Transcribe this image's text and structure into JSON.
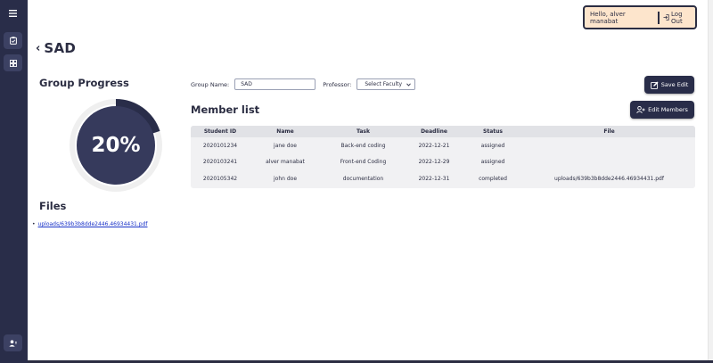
{
  "sidebar": {
    "icons": [
      "menu-icon",
      "clipboard-icon",
      "grid-icon",
      "user-icon"
    ]
  },
  "header": {
    "greeting": "Hello, alver manabat",
    "logout_label": "Log Out"
  },
  "page": {
    "back_icon": "chevron-left-icon",
    "title": "SAD"
  },
  "progress": {
    "heading": "Group Progress",
    "percent_label": "20%",
    "value": 0.2
  },
  "files": {
    "heading": "Files",
    "items": [
      "uploads/639b3b8dde2446.46934431.pdf"
    ]
  },
  "form": {
    "group_name_label": "Group Name:",
    "group_name_value": "SAD",
    "professor_label": "Professor:",
    "professor_selected": "Select Faculty"
  },
  "buttons": {
    "save_label": "Save Edit",
    "edit_members_label": "Edit Members"
  },
  "members": {
    "heading": "Member list",
    "columns": [
      "Student ID",
      "Name",
      "Task",
      "Deadline",
      "Status",
      "File"
    ],
    "rows": [
      {
        "id": "2020101234",
        "name": "jane doe",
        "task": "Back-end coding",
        "deadline": "2022-12-21",
        "status": "assigned",
        "file": ""
      },
      {
        "id": "2020103241",
        "name": "alver manabat",
        "task": "Front-end Coding",
        "deadline": "2022-12-29",
        "status": "assigned",
        "file": ""
      },
      {
        "id": "2020105342",
        "name": "john doe",
        "task": "documentation",
        "deadline": "2022-12-31",
        "status": "completed",
        "file": "uploads/639b3b8dde2446.46934431.pdf"
      }
    ]
  },
  "colors": {
    "sidebar": "#292d49",
    "accent": "#2b2d42",
    "user_box": "#fde5cc",
    "link": "#1a33c8"
  }
}
